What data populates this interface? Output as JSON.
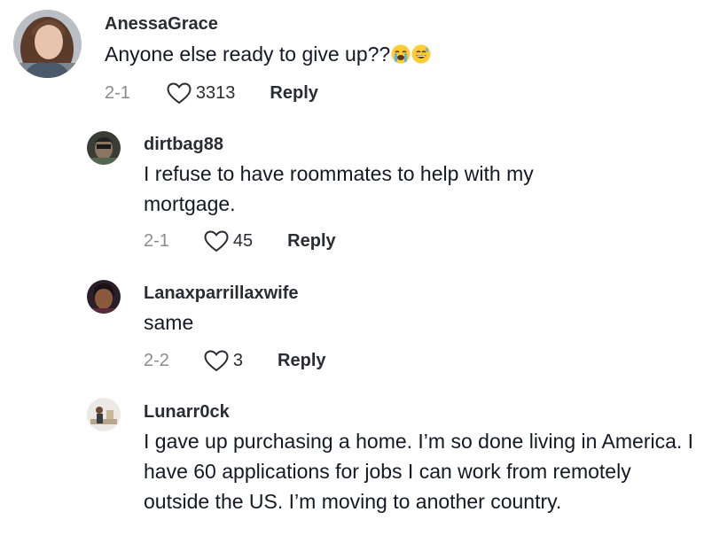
{
  "comments": [
    {
      "username": "AnessaGrace",
      "text": "Anyone else ready to give up??",
      "emojis": [
        "loudly-crying-face-emoji",
        "grinning-sweat-face-emoji"
      ],
      "date": "2-1",
      "likes": "3313",
      "reply_label": "Reply"
    },
    {
      "username": "dirtbag88",
      "text": "I refuse to have roommates to help with my mortgage.",
      "date": "2-1",
      "likes": "45",
      "reply_label": "Reply"
    },
    {
      "username": "Lanaxparrillaxwife",
      "text": "same",
      "date": "2-2",
      "likes": "3",
      "reply_label": "Reply"
    },
    {
      "username": "Lunarr0ck",
      "text": "I gave up purchasing a home. I’m so done living in America. I have 60 applications for jobs I can work from remotely outside the US. I’m moving to another country."
    }
  ],
  "icons": {
    "like": "heart-outline-icon"
  },
  "colors": {
    "text": "#161823",
    "secondary": "#8a8b91",
    "bold": "#2b2b33"
  }
}
